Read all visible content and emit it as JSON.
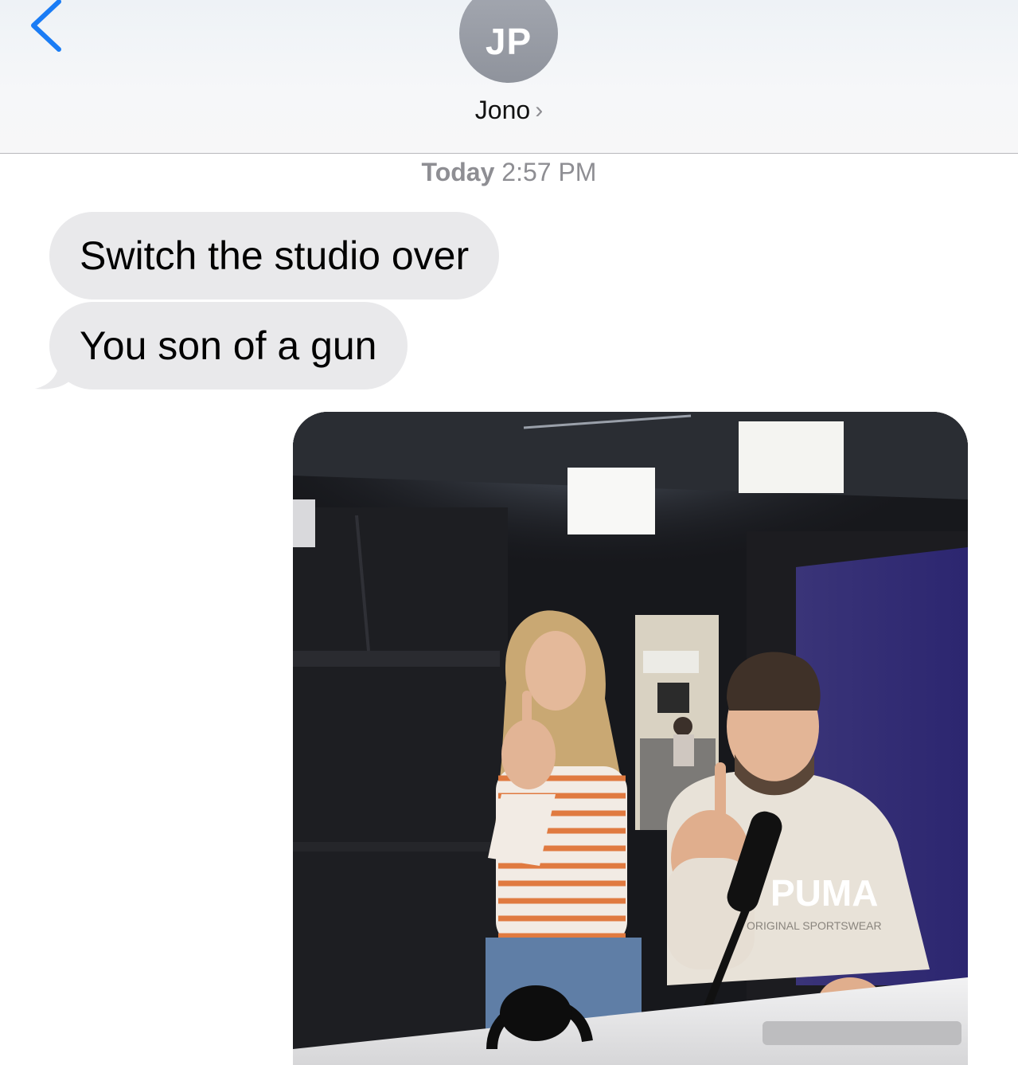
{
  "header": {
    "avatar_initials": "JP",
    "contact_name": "Jono",
    "contact_chevron": "›",
    "back_icon": "chevron-left-icon",
    "accent_color": "#1a7cf5"
  },
  "thread": {
    "timestamp_day": "Today",
    "timestamp_time": "2:57 PM",
    "messages": [
      {
        "direction": "incoming",
        "text": "Switch the studio over"
      },
      {
        "direction": "incoming",
        "text": "You son of a gun"
      }
    ],
    "attachment": {
      "type": "photo",
      "shirt_text_top": "PUMA",
      "shirt_text_bottom": "ORIGINAL SPORTSWEAR"
    }
  }
}
